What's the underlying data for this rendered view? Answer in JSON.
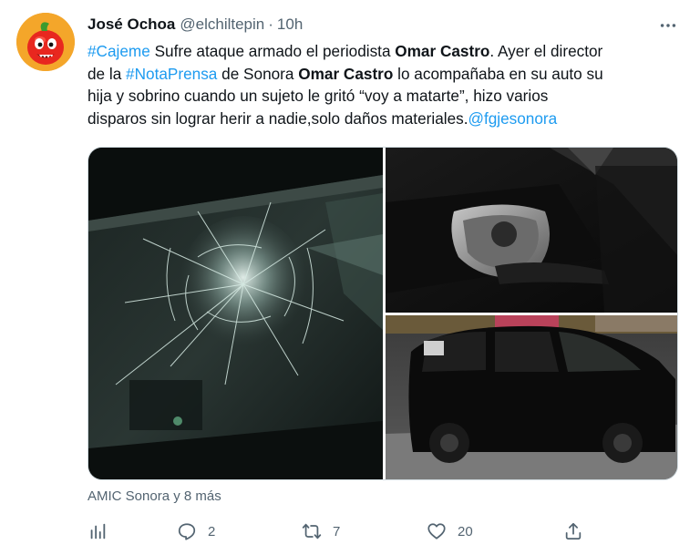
{
  "author": {
    "name": "José Ochoa",
    "handle": "@elchiltepin",
    "separator": "·",
    "time": "10h"
  },
  "more_icon": "more-horizontal-icon",
  "tweet_text": {
    "line1": {
      "hashtag": "#Cajeme",
      "t1": " Sufre ataque armado el periodista ",
      "bold1": "Omar Castro",
      "t2": ". Ayer el director"
    },
    "line2": {
      "t1": "de la ",
      "hashtag": "#NotaPrensa",
      "t2": " de Sonora ",
      "bold1": "Omar Castro",
      "t3": " lo acompañaba en su auto su"
    },
    "line3": {
      "t1": "hija y sobrino cuando un  sujeto le gritó “voy a matarte”, hizo varios"
    },
    "line4": {
      "t1": "disparos sin lograr herir a nadie,solo daños materiales.",
      "mention": "@fgjesonora"
    }
  },
  "media": [
    {
      "name": "photo-shattered-windshield"
    },
    {
      "name": "photo-damaged-side-mirror"
    },
    {
      "name": "photo-black-suv"
    }
  ],
  "attribution": "AMIC Sonora y 8 más",
  "actions": {
    "analytics_icon": "analytics-icon",
    "reply_icon": "reply-icon",
    "reply_count": "2",
    "retweet_icon": "retweet-icon",
    "retweet_count": "7",
    "like_icon": "heart-icon",
    "like_count": "20",
    "share_icon": "share-icon"
  },
  "colors": {
    "link": "#1d9bf0",
    "secondary_text": "#536471",
    "primary_text": "#0f1419"
  }
}
